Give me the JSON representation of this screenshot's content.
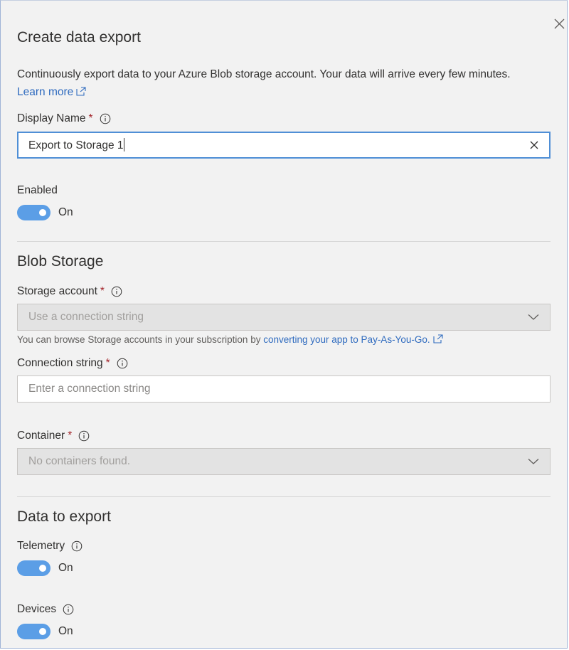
{
  "panel": {
    "title": "Create data export",
    "description": "Continuously export data to your Azure Blob storage account. Your data will arrive every few minutes.",
    "learn_more_label": "Learn more"
  },
  "display_name": {
    "label": "Display Name",
    "required_mark": "*",
    "value": "Export to Storage 1"
  },
  "enabled": {
    "label": "Enabled",
    "state_label": "On",
    "checked": true
  },
  "blob_storage": {
    "section_title": "Blob Storage",
    "storage_account": {
      "label": "Storage account",
      "required_mark": "*",
      "selected": "Use a connection string",
      "hint_prefix": "You can browse Storage accounts in your subscription by",
      "hint_link": "converting your app to Pay-As-You-Go."
    },
    "connection_string": {
      "label": "Connection string",
      "required_mark": "*",
      "placeholder": "Enter a connection string",
      "value": ""
    },
    "container": {
      "label": "Container",
      "required_mark": "*",
      "selected": "No containers found."
    }
  },
  "data_to_export": {
    "section_title": "Data to export",
    "telemetry": {
      "label": "Telemetry",
      "state_label": "On",
      "checked": true
    },
    "devices": {
      "label": "Devices",
      "state_label": "On",
      "checked": true
    }
  },
  "icons": {
    "close": "close-icon",
    "info": "info-icon",
    "external_link": "external-link-icon",
    "clear": "clear-icon",
    "chevron": "chevron-down-icon"
  },
  "colors": {
    "accent": "#5b9ee6",
    "link": "#2f6bbf",
    "required": "#a4262c",
    "panel_background": "#f2f2f2"
  }
}
